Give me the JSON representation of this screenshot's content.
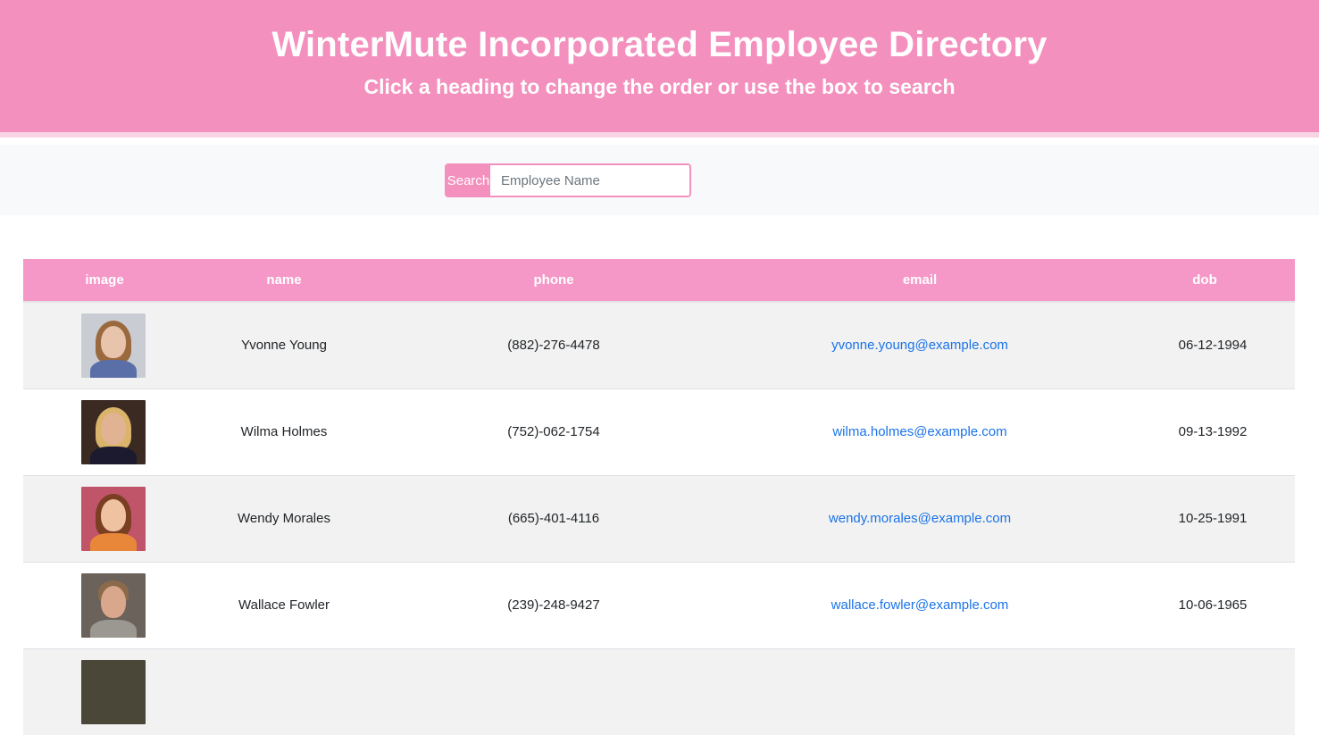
{
  "header": {
    "title": "WinterMute Incorporated Employee Directory",
    "subtitle": "Click a heading to change the order or use the box to search"
  },
  "search": {
    "label": "Search",
    "placeholder": "Employee Name",
    "value": ""
  },
  "table": {
    "columns": [
      "image",
      "name",
      "phone",
      "email",
      "dob"
    ],
    "rows": [
      {
        "name": "Yvonne Young",
        "phone": "(882)-276-4478",
        "email": "yvonne.young@example.com",
        "dob": "06-12-1994"
      },
      {
        "name": "Wilma Holmes",
        "phone": "(752)-062-1754",
        "email": "wilma.holmes@example.com",
        "dob": "09-13-1992"
      },
      {
        "name": "Wendy Morales",
        "phone": "(665)-401-4116",
        "email": "wendy.morales@example.com",
        "dob": "10-25-1991"
      },
      {
        "name": "Wallace Fowler",
        "phone": "(239)-248-9427",
        "email": "wallace.fowler@example.com",
        "dob": "10-06-1965"
      },
      {
        "name": "",
        "phone": "",
        "email": "",
        "dob": ""
      }
    ]
  },
  "colors": {
    "brand": "#f390bd",
    "table_header": "#f598c8",
    "link": "#1a73e8"
  }
}
